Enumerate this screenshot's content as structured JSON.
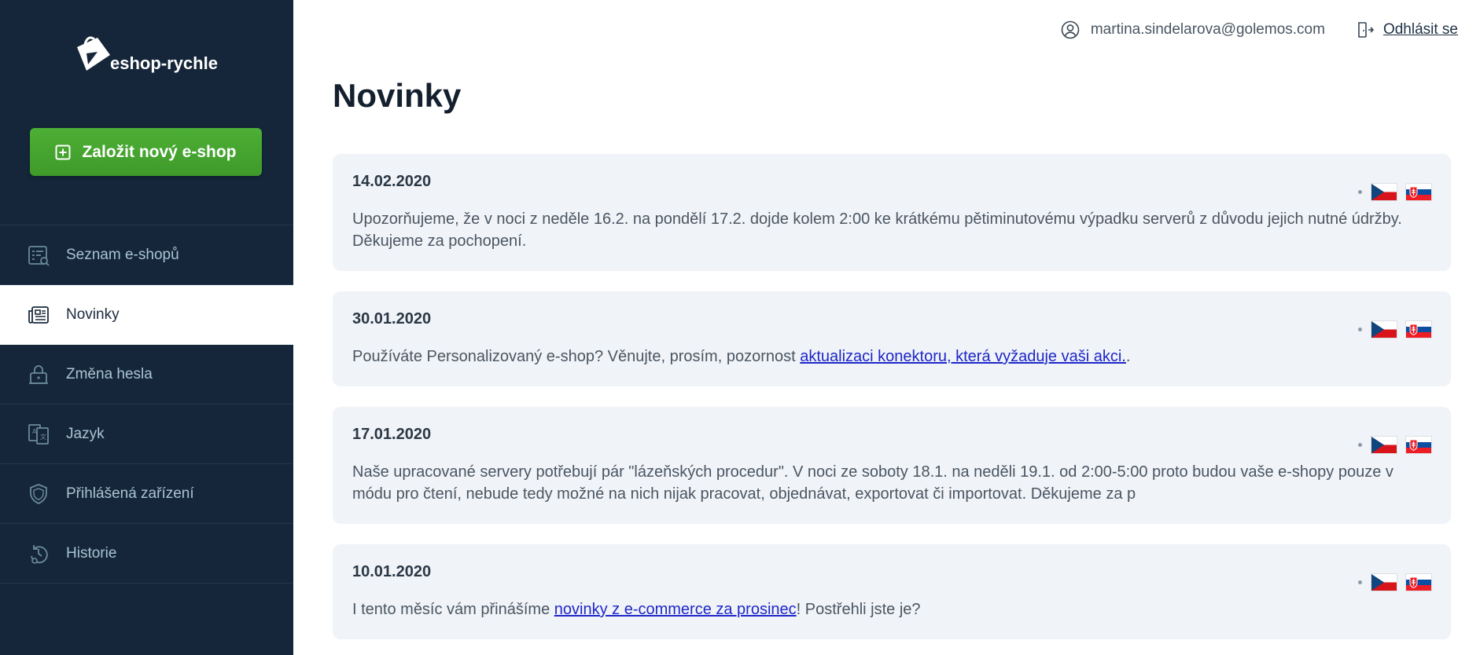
{
  "sidebar": {
    "logo_text": "eshop-rychle",
    "new_shop_label": "Založit nový e-shop",
    "items": [
      {
        "label": "Seznam e-shopů",
        "icon": "shop-list-icon"
      },
      {
        "label": "Novinky",
        "icon": "newspaper-icon",
        "active": true
      },
      {
        "label": "Změna hesla",
        "icon": "lock-icon"
      },
      {
        "label": "Jazyk",
        "icon": "language-icon"
      },
      {
        "label": "Přihlášená zařízení",
        "icon": "shield-icon"
      },
      {
        "label": "Historie",
        "icon": "history-icon"
      }
    ]
  },
  "header": {
    "user_email": "martina.sindelarova@golemos.com",
    "logout_label": "Odhlásit se"
  },
  "main": {
    "title": "Novinky",
    "news": [
      {
        "date": "14.02.2020",
        "text": "Upozorňujeme, že v noci z neděle 16.2. na pondělí 17.2. dojde kolem 2:00 ke krátkému pětiminutovému výpadku serverů z důvodu jejich nutné údržby. Děkujeme za pochopení."
      },
      {
        "date": "30.01.2020",
        "text_before": "Používáte Personalizovaný e-shop? Věnujte, prosím, pozornost ",
        "link": "aktualizaci konektoru, která vyžaduje vaši akci.",
        "text_after": "."
      },
      {
        "date": "17.01.2020",
        "text": "Naše upracované servery potřebují pár \"lázeňských procedur\". V noci ze soboty 18.1. na neděli 19.1. od 2:00-5:00 proto budou vaše e-shopy pouze v módu pro čtení, nebude tedy možné na nich nijak pracovat, objednávat, exportovat či importovat. Děkujeme za p"
      },
      {
        "date": "10.01.2020",
        "text_before": "I tento měsíc vám přinášíme ",
        "link": "novinky z e-commerce za prosinec",
        "text_after": "! Postřehli jste je?"
      }
    ]
  },
  "colors": {
    "sidebar_bg": "#15263a",
    "accent_green": "#47a831",
    "card_bg": "#f0f3f7",
    "link": "#1d27c9"
  }
}
